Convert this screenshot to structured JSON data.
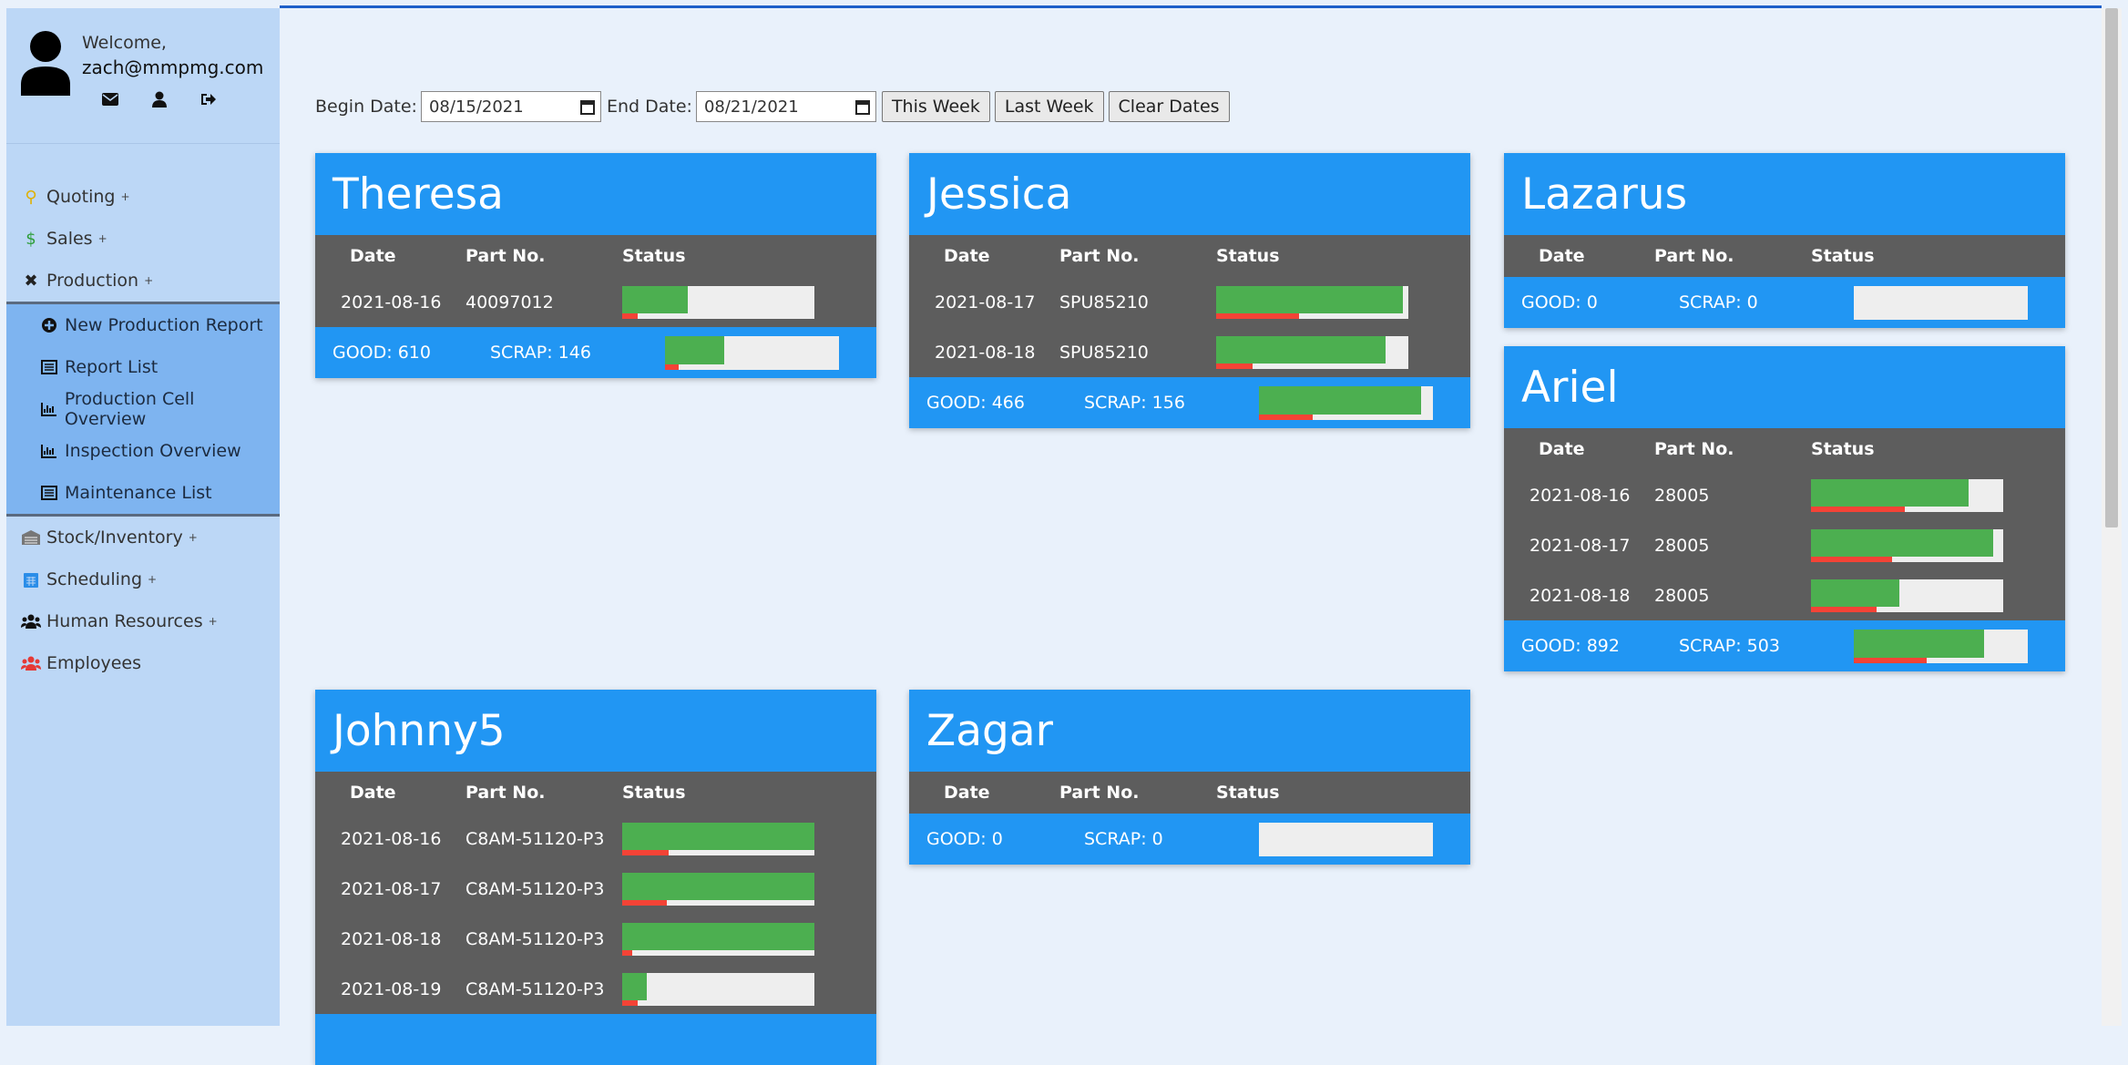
{
  "user": {
    "welcome": "Welcome,",
    "email": "zach@mmpmg.com"
  },
  "nav": {
    "items": [
      {
        "label": "Quoting",
        "plus": "+"
      },
      {
        "label": "Sales",
        "plus": "+"
      },
      {
        "label": "Production",
        "plus": "+"
      }
    ],
    "sub_items": [
      {
        "label": "New Production Report"
      },
      {
        "label": "Report List"
      },
      {
        "label": "Production Cell Overview"
      },
      {
        "label": "Inspection Overview"
      },
      {
        "label": "Maintenance List"
      }
    ],
    "items_after": [
      {
        "label": "Stock/Inventory",
        "plus": "+"
      },
      {
        "label": "Scheduling",
        "plus": "+"
      },
      {
        "label": "Human Resources",
        "plus": "+"
      },
      {
        "label": "Employees"
      }
    ]
  },
  "filters": {
    "begin_label": "Begin Date:",
    "begin_value": "08/15/2021",
    "end_label": "End Date:",
    "end_value": "08/21/2021",
    "this_week": "This Week",
    "last_week": "Last Week",
    "clear": "Clear Dates"
  },
  "table_headers": {
    "date": "Date",
    "part": "Part No.",
    "status": "Status"
  },
  "cards": [
    {
      "name": "Theresa",
      "rows": [
        {
          "date": "2021-08-16",
          "part": "40097012",
          "good": 0.34,
          "scrap": 0.08
        }
      ],
      "good": "GOOD: 610",
      "scrap": "SCRAP: 146",
      "total_good": 0.34,
      "total_scrap": 0.08
    },
    {
      "name": "Jessica",
      "rows": [
        {
          "date": "2021-08-17",
          "part": "SPU85210",
          "good": 0.97,
          "scrap": 0.43
        },
        {
          "date": "2021-08-18",
          "part": "SPU85210",
          "good": 0.88,
          "scrap": 0.19
        }
      ],
      "good": "GOOD: 466",
      "scrap": "SCRAP: 156",
      "total_good": 0.93,
      "total_scrap": 0.31
    },
    {
      "name": "Lazarus",
      "rows": [],
      "good": "GOOD: 0",
      "scrap": "SCRAP: 0",
      "total_good": 0,
      "total_scrap": 0
    },
    {
      "name": "Ariel",
      "rows": [
        {
          "date": "2021-08-16",
          "part": "28005",
          "good": 0.82,
          "scrap": 0.49
        },
        {
          "date": "2021-08-17",
          "part": "28005",
          "good": 0.95,
          "scrap": 0.42
        },
        {
          "date": "2021-08-18",
          "part": "28005",
          "good": 0.46,
          "scrap": 0.34
        }
      ],
      "good": "GOOD: 892",
      "scrap": "SCRAP: 503",
      "total_good": 0.75,
      "total_scrap": 0.42
    },
    {
      "name": "Johnny5",
      "rows": [
        {
          "date": "2021-08-16",
          "part": "C8AM-51120-P3",
          "good": 1.0,
          "scrap": 0.24
        },
        {
          "date": "2021-08-17",
          "part": "C8AM-51120-P3",
          "good": 1.0,
          "scrap": 0.23
        },
        {
          "date": "2021-08-18",
          "part": "C8AM-51120-P3",
          "good": 1.0,
          "scrap": 0.05
        },
        {
          "date": "2021-08-19",
          "part": "C8AM-51120-P3",
          "good": 0.13,
          "scrap": 0.08
        }
      ],
      "good": "",
      "scrap": "",
      "total_good": 0,
      "total_scrap": 0
    },
    {
      "name": "Zagar",
      "rows": [],
      "good": "GOOD: 0",
      "scrap": "SCRAP: 0",
      "total_good": 0,
      "total_scrap": 0
    }
  ],
  "colors": {
    "accent": "#2196f3",
    "good": "#4caf50",
    "scrap": "#f44336",
    "table": "#5d5d5d"
  }
}
